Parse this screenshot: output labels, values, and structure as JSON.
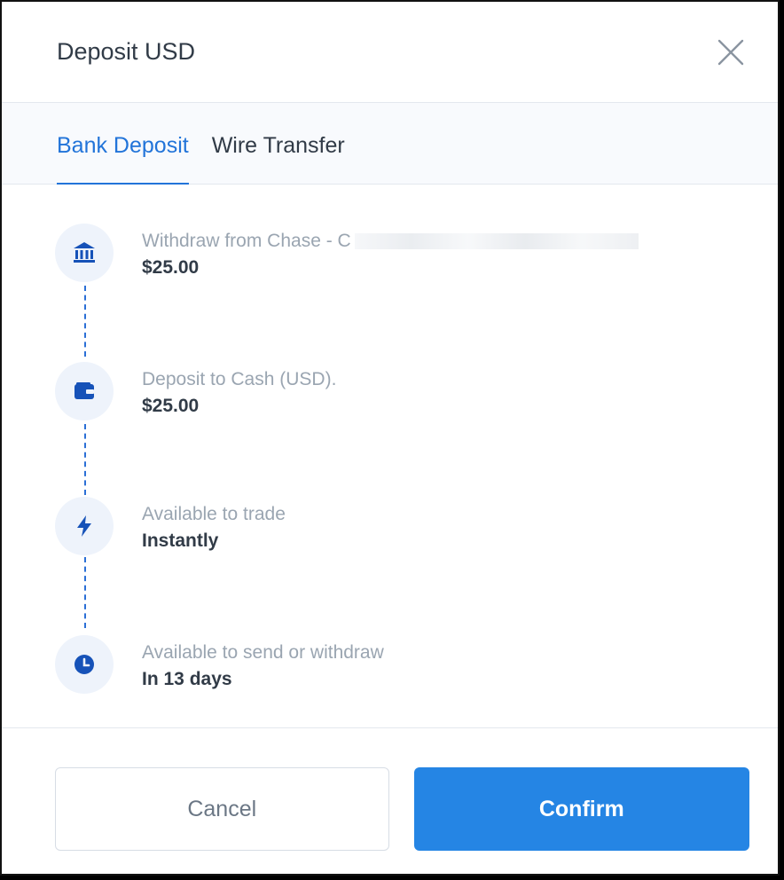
{
  "header": {
    "title": "Deposit USD",
    "close_icon": "close-icon"
  },
  "tabs": [
    {
      "label": "Bank Deposit",
      "active": true
    },
    {
      "label": "Wire Transfer",
      "active": false
    }
  ],
  "steps": [
    {
      "icon": "bank-icon",
      "label": "Withdraw from Chase - C",
      "value": "$25.00"
    },
    {
      "icon": "wallet-icon",
      "label": "Deposit to Cash (USD).",
      "value": "$25.00"
    },
    {
      "icon": "lightning-icon",
      "label": "Available to trade",
      "value": "Instantly"
    },
    {
      "icon": "clock-icon",
      "label": "Available to send or withdraw",
      "value": "In 13 days"
    }
  ],
  "footer": {
    "cancel_label": "Cancel",
    "confirm_label": "Confirm"
  },
  "colors": {
    "accent": "#2585e4",
    "tab_active": "#2274d9",
    "icon_bg": "#eef3fb",
    "text": "#313b47",
    "muted": "#9aa5b1"
  }
}
